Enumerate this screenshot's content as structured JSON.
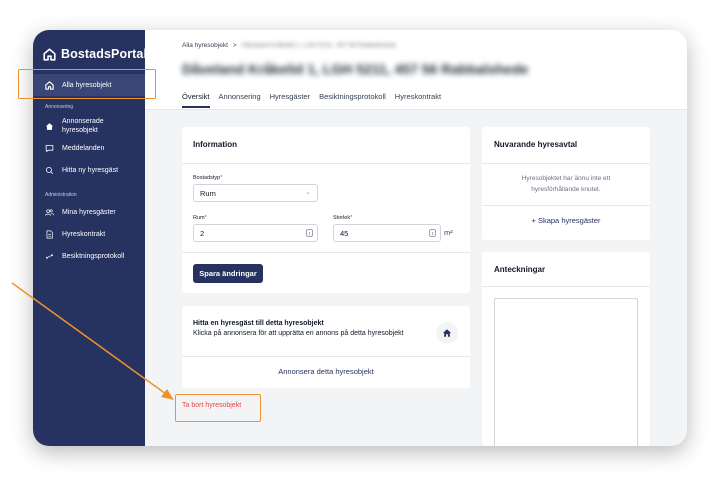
{
  "app": {
    "name": "BostadsPortal"
  },
  "sidebar": {
    "active_item": "Alla hyresobjekt",
    "sections": [
      {
        "label": "Annonsering",
        "items": [
          "Annonserade hyresobjekt",
          "Meddelanden",
          "Hitta ny hyresgäst"
        ]
      },
      {
        "label": "Administration",
        "items": [
          "Mina hyresgäster",
          "Hyreskontrakt",
          "Besiktningsprotokoll"
        ]
      }
    ],
    "icons": [
      "home-icon",
      "house-icon",
      "chat-icon",
      "search-icon",
      "users-icon",
      "document-icon",
      "swap-icon"
    ]
  },
  "header": {
    "breadcrumb_root": "Alla hyresobjekt",
    "breadcrumb_separator": ">",
    "breadcrumb_current": "Dåveland Kråkelid 1, LGH 5211, 457 56 Rabbalshede",
    "title": "Dåveland Kråkelid 1, LGH 5211, 457 56 Rabbalshede",
    "tabs": [
      "Översikt",
      "Annonsering",
      "Hyresgäster",
      "Besiktningsprotokoll",
      "Hyreskontrakt"
    ],
    "active_tab": "Översikt"
  },
  "information": {
    "title": "Information",
    "bostadstyp_label": "Bostadstyp",
    "bostadstyp_value": "Rum",
    "rum_label": "Rum",
    "rum_value": "2",
    "storlek_label": "Storlek",
    "storlek_value": "45",
    "storlek_unit": "m²",
    "required_mark": "*",
    "save_button": "Spara ändringar"
  },
  "find_tenant": {
    "title": "Hitta en hyresgäst till detta hyresobjekt",
    "description": "Klicka på annonsera för att upprätta en annons på detta hyresobjekt",
    "action": "Annonsera detta hyresobjekt"
  },
  "delete_link": "Ta bort hyresobjekt",
  "current_lease": {
    "title": "Nuvarande hyresavtal",
    "empty_line1": "Hyresobjektet har ännu inte ett",
    "empty_line2": "hyresförhållande knutet.",
    "create_action": "+ Skapa hyresgäster"
  },
  "notes": {
    "title": "Anteckningar"
  },
  "colors": {
    "sidebar": "#26325f",
    "accent": "#26325f",
    "danger": "#ef4444",
    "highlight": "#f0922b"
  }
}
